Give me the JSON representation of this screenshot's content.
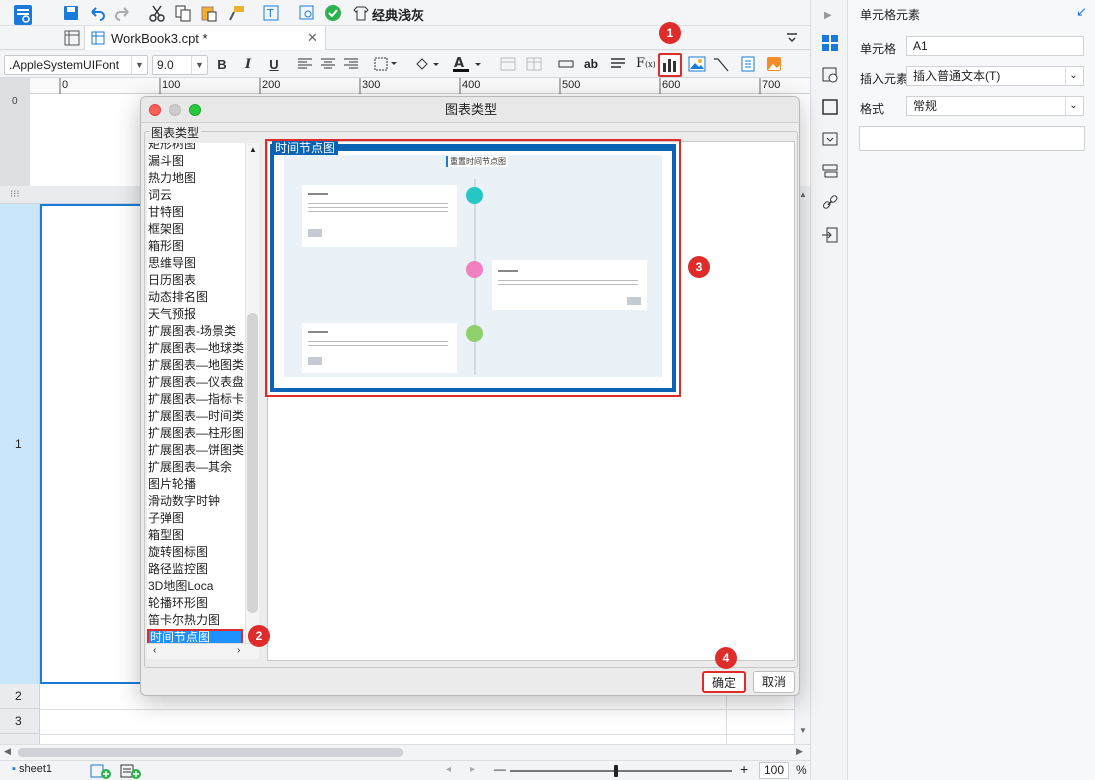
{
  "toolbar": {
    "theme_label": "经典浅灰"
  },
  "tab": {
    "title": "WorkBook3.cpt *"
  },
  "format": {
    "font_name": ".AppleSystemUIFont",
    "font_size": "9.0"
  },
  "ruler": {
    "ticks": [
      "0",
      "100",
      "200",
      "300",
      "400",
      "500",
      "600",
      "700"
    ]
  },
  "rows": {
    "r1": "1",
    "r2": "2",
    "r3": "3"
  },
  "right_panel": {
    "title": "单元格元素",
    "cell_label": "单元格",
    "cell_value": "A1",
    "insert_label": "插入元素",
    "insert_value": "插入普通文本(T)",
    "format_label": "格式",
    "format_value": "常规"
  },
  "dialog": {
    "title": "图表类型",
    "group_label": "图表类型",
    "preview_label": "时间节点图",
    "preview_chart_title": "重置时间节点图",
    "confirm": "确定",
    "cancel": "取消",
    "scrollbar": "sheet1"
  },
  "chart_types": [
    "矩形树图",
    "漏斗图",
    "热力地图",
    "词云",
    "甘特图",
    "框架图",
    "箱形图",
    "思维导图",
    "日历图表",
    "动态排名图",
    "天气预报",
    "扩展图表-场景类",
    "扩展图表—地球类",
    "扩展图表—地图类",
    "扩展图表—仪表盘",
    "扩展图表—指标卡",
    "扩展图表—时间类",
    "扩展图表—柱形图",
    "扩展图表—饼图类",
    "扩展图表—其余",
    "图片轮播",
    "滑动数字时钟",
    "子弹图",
    "箱型图",
    "旋转图标图",
    "路径监控图",
    "3D地图Loca",
    "轮播环形图",
    "笛卡尔热力图",
    "时间节点图"
  ],
  "selected_index": 29,
  "badges": [
    "1",
    "2",
    "3",
    "4"
  ],
  "status": {
    "sheet": "sheet1",
    "zoom": "100",
    "percent": "%",
    "minus": "—",
    "plus": "+"
  },
  "colors": {
    "accent": "#1a7ad9",
    "selected": "#1e90ff",
    "badge": "#e02b2b"
  }
}
